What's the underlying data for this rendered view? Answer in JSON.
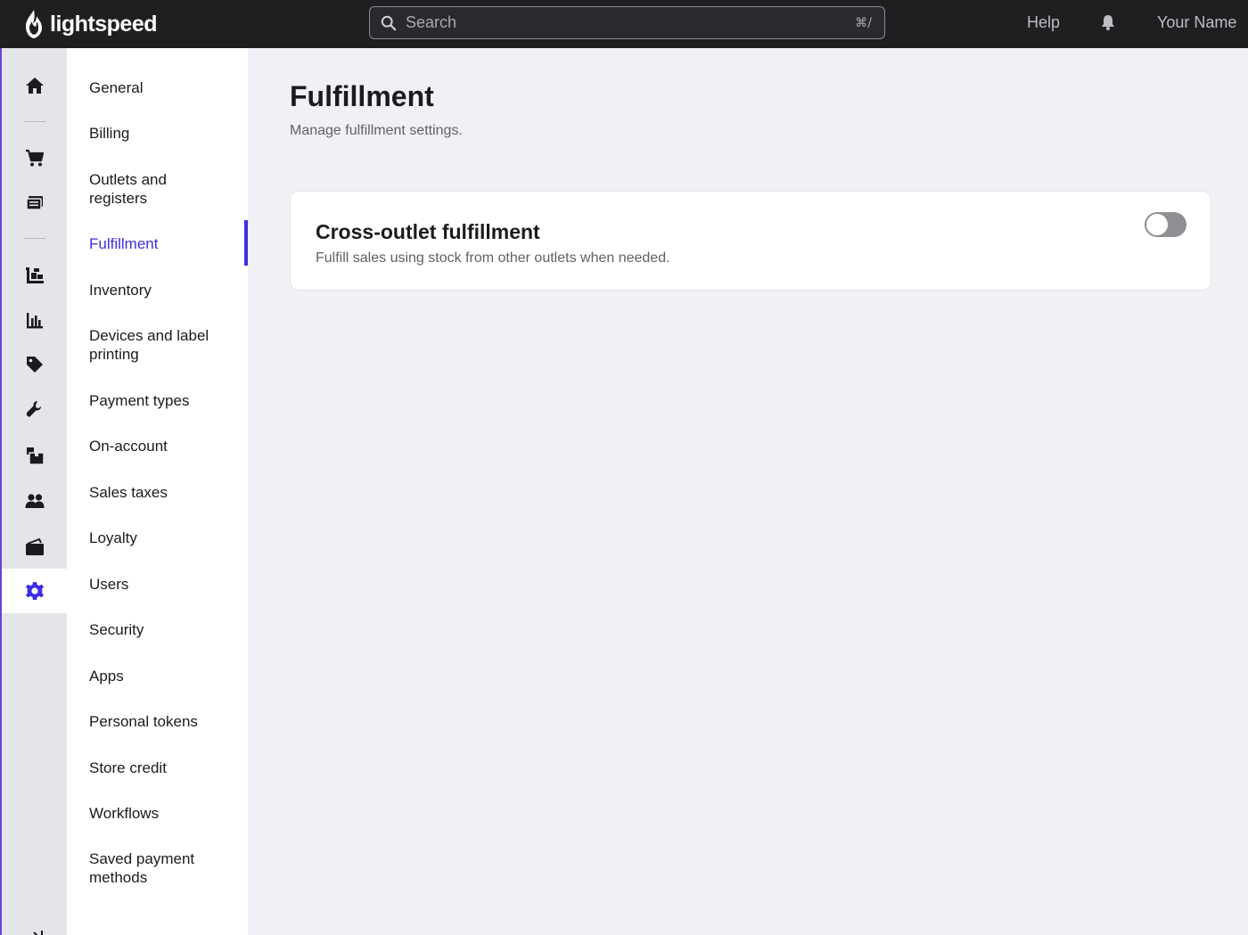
{
  "app": {
    "brand": "lightspeed"
  },
  "topbar": {
    "search_placeholder": "Search",
    "search_shortcut": "⌘/",
    "help_label": "Help",
    "user_name": "Your Name"
  },
  "rail": {
    "icons": [
      "home-icon",
      "cart-icon",
      "register-icon",
      "catalog-icon",
      "reports-icon",
      "price-tag-icon",
      "wrench-icon",
      "inventory-icon",
      "customers-icon",
      "wallet-icon",
      "gear-icon",
      "collapse-icon"
    ],
    "active": "gear-icon",
    "accent_color": "#3d2ee0"
  },
  "subnav": {
    "items": [
      {
        "label": "General"
      },
      {
        "label": "Billing"
      },
      {
        "label": "Outlets and registers"
      },
      {
        "label": "Fulfillment"
      },
      {
        "label": "Inventory"
      },
      {
        "label": "Devices and label printing"
      },
      {
        "label": "Payment types"
      },
      {
        "label": "On-account"
      },
      {
        "label": "Sales taxes"
      },
      {
        "label": "Loyalty"
      },
      {
        "label": "Users"
      },
      {
        "label": "Security"
      },
      {
        "label": "Apps"
      },
      {
        "label": "Personal tokens"
      },
      {
        "label": "Store credit"
      },
      {
        "label": "Workflows"
      },
      {
        "label": "Saved payment methods"
      }
    ],
    "active_label": "Fulfillment"
  },
  "main": {
    "title": "Fulfillment",
    "subtitle": "Manage fulfillment settings.",
    "card": {
      "title": "Cross-outlet fulfillment",
      "description": "Fulfill sales using stock from other outlets when needed.",
      "toggle_on": false
    }
  }
}
